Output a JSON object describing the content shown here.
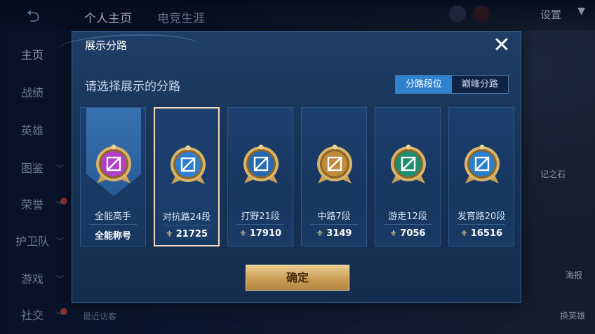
{
  "topbar": {
    "tabs": [
      "个人主页",
      "电竞生涯"
    ],
    "settings_label": "设置"
  },
  "sidebar": {
    "items": [
      {
        "label": "主页",
        "chevron": false
      },
      {
        "label": "战绩",
        "chevron": false
      },
      {
        "label": "英雄",
        "chevron": false
      },
      {
        "label": "图鉴",
        "chevron": true
      },
      {
        "label": "荣誉",
        "chevron": true
      },
      {
        "label": "护卫队",
        "chevron": true
      },
      {
        "label": "游戏",
        "chevron": true
      },
      {
        "label": "社交",
        "chevron": true
      }
    ]
  },
  "footer": {
    "recent_visitors": "最近访客"
  },
  "right_panel": {
    "item1": "海报",
    "item2": "换英雄",
    "item3": "记之石"
  },
  "dialog": {
    "title": "展示分路",
    "subtitle": "请选择展示的分路",
    "segment": [
      "分路段位",
      "巅峰分路"
    ],
    "confirm_label": "确定",
    "cards": [
      {
        "name": "全能高手",
        "score": "全能称号",
        "emblem_color": "#b23fc6",
        "icon": "allround-icon"
      },
      {
        "name": "对抗路24段",
        "score": "21725",
        "emblem_color": "#2e7fd0",
        "icon": "clash-lane-icon"
      },
      {
        "name": "打野21段",
        "score": "17910",
        "emblem_color": "#2468b8",
        "icon": "jungle-icon"
      },
      {
        "name": "中路7段",
        "score": "3149",
        "emblem_color": "#c08a3a",
        "icon": "mid-lane-icon"
      },
      {
        "name": "游走12段",
        "score": "7056",
        "emblem_color": "#1e8f6e",
        "icon": "roam-icon"
      },
      {
        "name": "发育路20段",
        "score": "16516",
        "emblem_color": "#2a7fcf",
        "icon": "farm-lane-icon"
      }
    ]
  }
}
